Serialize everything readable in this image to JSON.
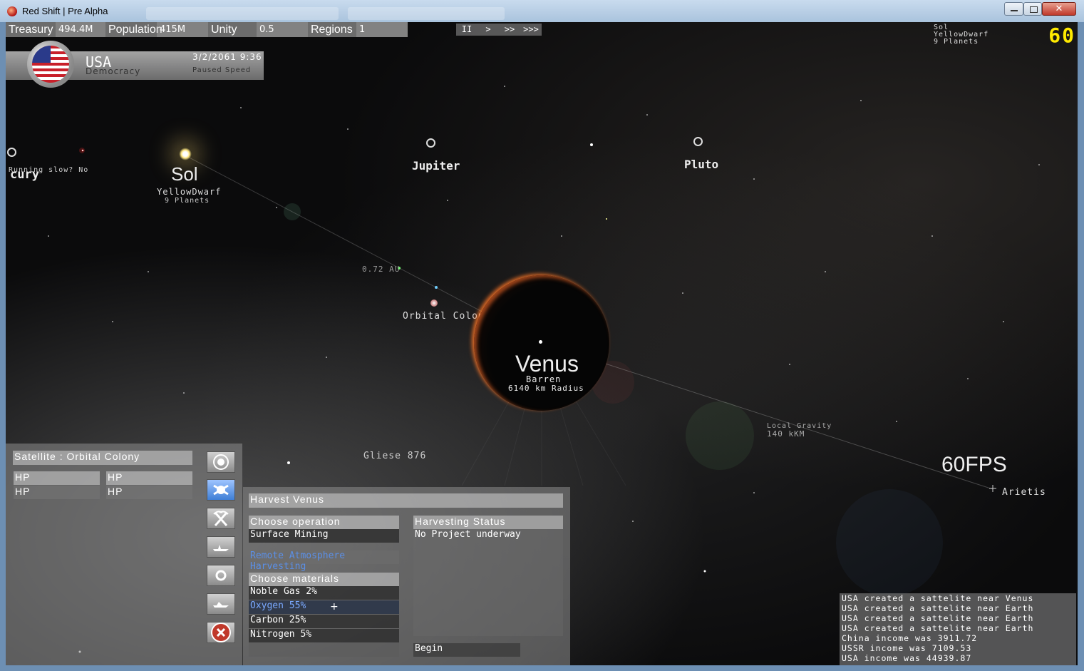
{
  "window": {
    "title": "Red Shift | Pre Alpha"
  },
  "topbar": {
    "treasury_label": "Treasury",
    "treasury_value": "494.4M",
    "population_label": "Population",
    "population_value": "415M",
    "unity_label": "Unity",
    "unity_value": "0.5",
    "regions_label": "Regions",
    "regions_value": "1"
  },
  "speed": {
    "pause": "II",
    "play": ">",
    "fast": ">>",
    "fastest": ">>>"
  },
  "nation": {
    "name": "USA",
    "government": "Democracy",
    "date": "3/2/2061  9:36",
    "speed_status": "Paused Speed"
  },
  "system_info": {
    "star": "Sol",
    "type": "YellowDwarf",
    "planets": "9 Planets"
  },
  "fps_counter": "60",
  "map": {
    "sun": {
      "name": "Sol",
      "type": "YellowDwarf",
      "planets": "9 Planets"
    },
    "mercury_label": "cury",
    "running_slow": "Running slow? No",
    "jupiter": "Jupiter",
    "pluto": "Pluto",
    "distance": "0.72 AU",
    "orbital_colony": "Orbital Colony",
    "venus": {
      "name": "Venus",
      "type": "Barren",
      "radius": "6140 km Radius"
    },
    "gliese": "Gliese 876",
    "local_gravity": "Local Gravity",
    "gravity_value": "140 kKM",
    "fps_big": "60FPS",
    "arietis": "Arietis"
  },
  "satellite_panel": {
    "title": "Satellite : Orbital Colony",
    "hp1_header": "HP",
    "hp1_value": "HP",
    "hp2_header": "HP",
    "hp2_value": "HP"
  },
  "harvest_panel": {
    "title": "Harvest Venus",
    "choose_operation": "Choose operation",
    "operations": [
      "Surface Mining",
      "Remote Atmosphere Harvesting"
    ],
    "choose_materials": "Choose materials",
    "materials": [
      "Noble Gas 2%",
      "Oxygen 55%",
      "Carbon 25%",
      "Nitrogen 5%"
    ],
    "status_title": "Harvesting Status",
    "status_text": "No Project underway",
    "begin": "Begin"
  },
  "log": [
    "USA created a sattelite near Venus",
    "USA created a sattelite near Earth",
    "USA created a sattelite near Earth",
    "USA created a sattelite near Earth",
    "China income was 3911.72",
    "USSR income was 7109.53",
    "USA income was 44939.87"
  ],
  "colors": {
    "accent": "#ffea00",
    "selection": "#3f7fd6",
    "venus_glow": "#ff7828"
  }
}
